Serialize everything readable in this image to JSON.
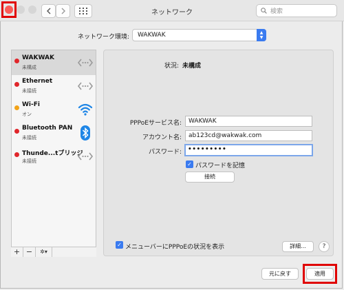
{
  "window": {
    "title": "ネットワーク"
  },
  "toolbar": {
    "back_icon": "chevron-left-icon",
    "forward_icon": "chevron-right-icon",
    "grid_icon": "grid-icon",
    "search_placeholder": "検索"
  },
  "location": {
    "label": "ネットワーク環境:",
    "value": "WAKWAK"
  },
  "services": [
    {
      "name": "WAKWAK",
      "status": "未構成",
      "status_color": "#e0262b",
      "icon": "ppp-icon"
    },
    {
      "name": "Ethernet",
      "status": "未接続",
      "status_color": "#e0262b",
      "icon": "ethernet-icon"
    },
    {
      "name": "Wi-Fi",
      "status": "オン",
      "status_color": "#f2a319",
      "icon": "wifi-icon"
    },
    {
      "name": "Bluetooth PAN",
      "status": "未接続",
      "status_color": "#e0262b",
      "icon": "bluetooth-icon"
    },
    {
      "name": "Thunde...tブリッジ",
      "status": "未接続",
      "status_color": "#e0262b",
      "icon": "thunderbolt-bridge-icon"
    }
  ],
  "sidebar_controls": {
    "add": "+",
    "remove": "−",
    "action": "✲▾"
  },
  "detail": {
    "status_label": "状況:",
    "status_value": "未構成",
    "pppoe_label": "PPPoEサービス名:",
    "pppoe_value": "WAKWAK",
    "account_label": "アカウント名:",
    "account_value": "ab123cd@wakwak.com",
    "password_label": "パスワード:",
    "password_value": "•••••••••",
    "remember_label": "パスワードを記憶",
    "connect_label": "接続",
    "menubar_label": "メニューバーにPPPoEの状況を表示",
    "advanced_label": "詳細...",
    "help_label": "?"
  },
  "footer": {
    "revert_label": "元に戻す",
    "apply_label": "適用"
  },
  "colors": {
    "accent": "#3a7bf0",
    "highlight": "#e00000"
  }
}
